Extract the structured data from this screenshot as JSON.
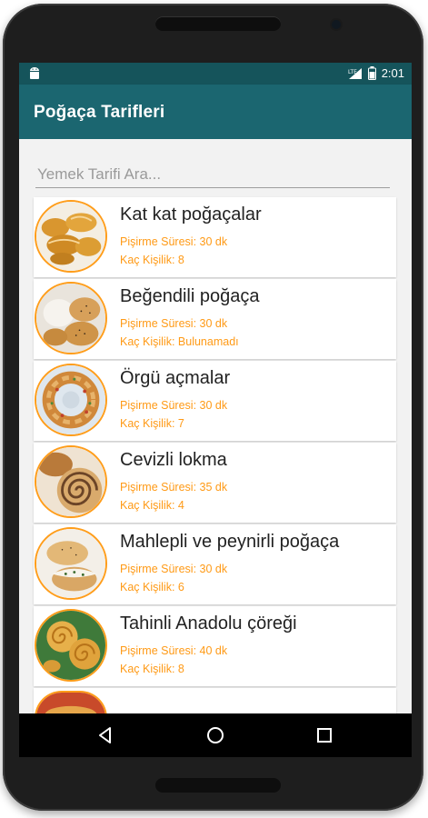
{
  "statusbar": {
    "time": "2:01",
    "network": "LTE"
  },
  "appbar": {
    "title": "Poğaça Tarifleri"
  },
  "search": {
    "placeholder": "Yemek Tarifi Ara...",
    "value": ""
  },
  "recipes": [
    {
      "title": "Kat kat poğaçalar",
      "time": "Pişirme Süresi: 30 dk",
      "servings": "Kaç Kişilik: 8"
    },
    {
      "title": "Beğendili poğaça",
      "time": "Pişirme Süresi: 30 dk",
      "servings": "Kaç Kişilik: Bulunamadı"
    },
    {
      "title": "Örgü açmalar",
      "time": "Pişirme Süresi: 30 dk",
      "servings": "Kaç Kişilik: 7"
    },
    {
      "title": "Cevizli lokma",
      "time": "Pişirme Süresi: 35 dk",
      "servings": "Kaç Kişilik: 4"
    },
    {
      "title": "Mahlepli ve peynirli poğaça",
      "time": "Pişirme Süresi: 30 dk",
      "servings": "Kaç Kişilik: 6"
    },
    {
      "title": "Tahinli Anadolu çöreği",
      "time": "Pişirme Süresi: 40 dk",
      "servings": "Kaç Kişilik: 8"
    }
  ],
  "navbar": {
    "back": "back-icon",
    "home": "home-icon",
    "recents": "recents-icon"
  },
  "colors": {
    "statusbar": "#15545b",
    "appbar": "#1b6670",
    "accent": "#ff9a16"
  }
}
